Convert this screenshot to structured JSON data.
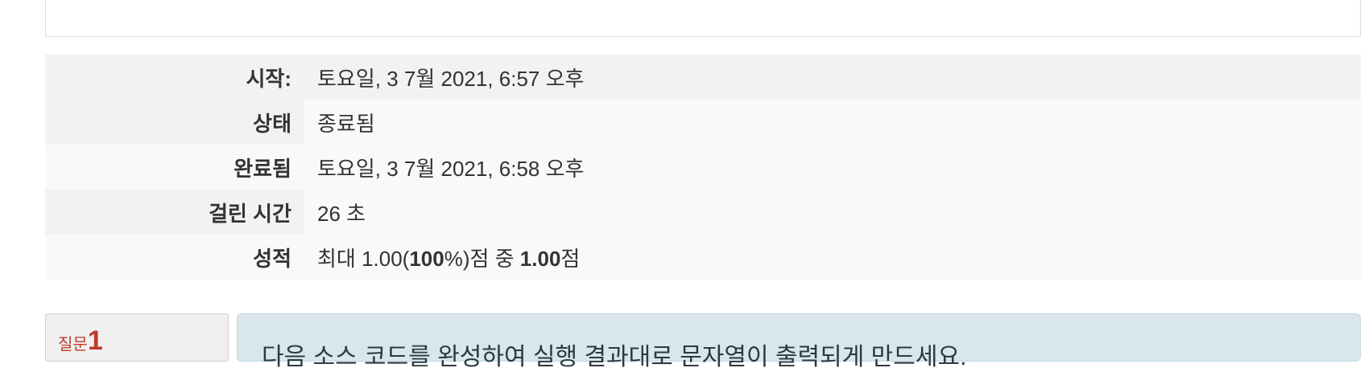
{
  "summary": {
    "rows": [
      {
        "label": "시작:",
        "value": "토요일, 3 7월 2021, 6:57 오후"
      },
      {
        "label": "상태",
        "value": "종료됨"
      },
      {
        "label": "완료됨",
        "value": "토요일, 3 7월 2021, 6:58 오후"
      },
      {
        "label": "걸린 시간",
        "value": "26 초"
      },
      {
        "label": "성적",
        "value_parts": [
          "최대 1.00(",
          "100",
          "%)점 중 ",
          "1.00",
          "점"
        ]
      }
    ]
  },
  "question": {
    "label_word": "질문",
    "number": "1",
    "text": "다음 소스 코드를 완성하여 실행 결과대로 문자열이 출력되게 만드세요."
  },
  "colors": {
    "question_label": "#c0392b",
    "question_content_bg": "#d9e7ec",
    "summary_row_dark": "#f2f2f2",
    "summary_row_light": "#f9f9f9"
  }
}
